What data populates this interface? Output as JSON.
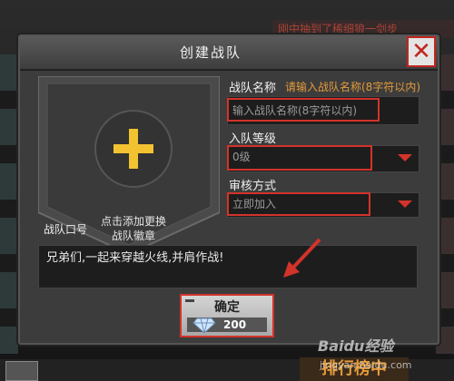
{
  "background": {
    "top_banner_text": "刚中抽到了稀细狼一剑步",
    "bottom_right_text": "排行榜中"
  },
  "dialog": {
    "title": "创建战队",
    "close_icon": "close-x-icon",
    "emblem": {
      "icon": "plus-icon",
      "hint_line1": "点击添加更换",
      "hint_line2": "战队徽章"
    },
    "name_field": {
      "label": "战队名称",
      "hint": "请输入战队名称(8字符以内)",
      "placeholder": "输入战队名称(8字符以内)"
    },
    "level_field": {
      "label": "入队等级",
      "value": "0级"
    },
    "review_field": {
      "label": "审核方式",
      "value": "立即加入"
    },
    "slogan": {
      "label": "战队口号",
      "value": "兄弟们,一起来穿越火线,并肩作战!"
    },
    "confirm": {
      "label": "确定",
      "cost": "200",
      "cost_icon": "diamond-icon"
    }
  },
  "watermark": {
    "brand": "Baidu经验",
    "url": "jingyan.baidu.com"
  },
  "colors": {
    "accent_red": "#d2332a",
    "hint_orange": "#e59b3a",
    "plus_yellow": "#f2c230"
  }
}
